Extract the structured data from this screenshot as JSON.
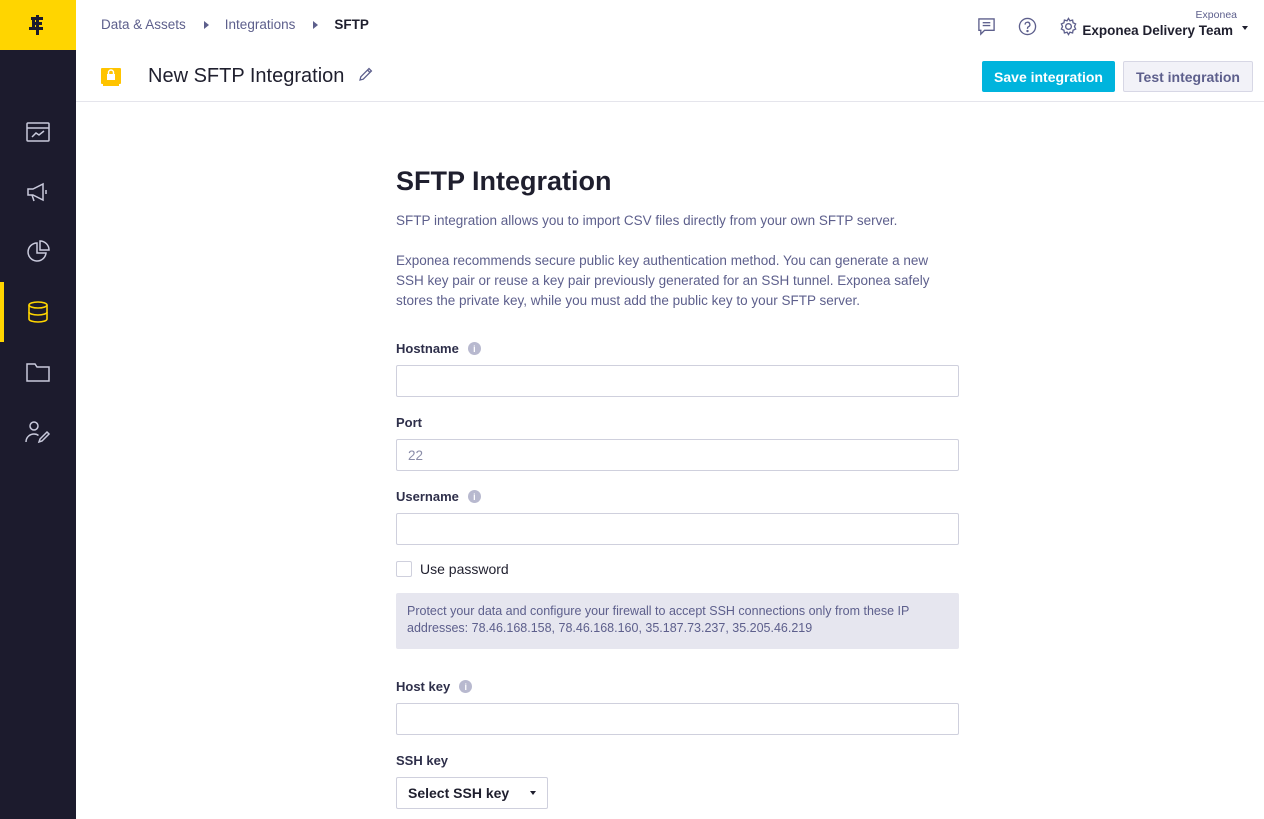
{
  "sidebar": {
    "logo": "exponea-logo",
    "items": [
      {
        "name": "dashboards",
        "icon": "calendar-chart-icon"
      },
      {
        "name": "campaigns",
        "icon": "megaphone-icon"
      },
      {
        "name": "analyses",
        "icon": "pie-chart-icon"
      },
      {
        "name": "data-assets",
        "icon": "database-icon",
        "active": true
      },
      {
        "name": "files",
        "icon": "folder-icon"
      },
      {
        "name": "customers",
        "icon": "user-edit-icon"
      }
    ],
    "accent_color": "#ffd500",
    "background_color": "#1c1b2d"
  },
  "breadcrumb": {
    "items": [
      "Data & Assets",
      "Integrations"
    ],
    "current": "SFTP"
  },
  "top_icons": [
    "chat-icon",
    "help-icon",
    "settings-icon"
  ],
  "account": {
    "organization": "Exponea",
    "team": "Exponea Delivery Team"
  },
  "page": {
    "title": "New SFTP Integration",
    "save_label": "Save integration",
    "test_label": "Test integration",
    "primary_color": "#00b4dd"
  },
  "form": {
    "heading": "SFTP Integration",
    "intro": "SFTP integration allows you to import CSV files directly from your own SFTP server.",
    "description": "Exponea recommends secure public key authentication method. You can generate a new SSH key pair or reuse a key pair previously generated for an SSH tunnel. Exponea safely stores the private key, while you must add the public key to your SFTP server.",
    "hostname_label": "Hostname",
    "hostname_value": "",
    "port_label": "Port",
    "port_placeholder": "22",
    "username_label": "Username",
    "username_value": "",
    "use_password_label": "Use password",
    "use_password_checked": false,
    "notice": "Protect your data and configure your firewall to accept SSH connections only from these IP addresses: 78.46.168.158, 78.46.168.160, 35.187.73.237, 35.205.46.219",
    "host_key_label": "Host key",
    "host_key_value": "",
    "ssh_key_label": "SSH key",
    "ssh_key_select": "Select SSH key"
  }
}
